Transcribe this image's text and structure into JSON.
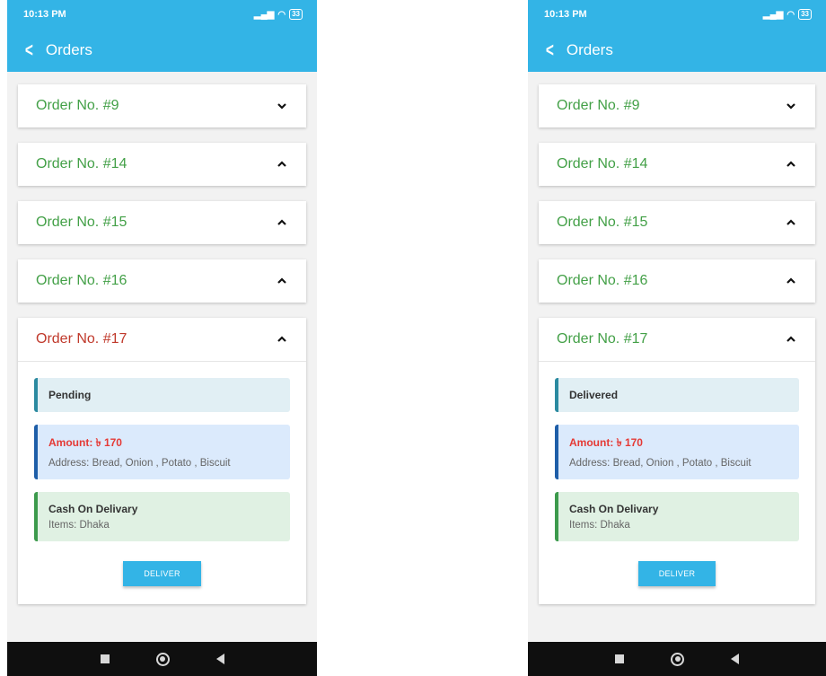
{
  "screens": [
    {
      "status": {
        "time": "10:13 PM",
        "battery": "33"
      },
      "appbar": {
        "back_icon": "chevron-left-icon",
        "title": "Orders"
      },
      "orders": [
        {
          "title": "Order No. #9"
        },
        {
          "title": "Order No. #14"
        },
        {
          "title": "Order No. #15"
        },
        {
          "title": "Order No. #16"
        },
        {
          "title": "Order No. #17"
        }
      ],
      "expanded": {
        "status": "Pending",
        "amount": "Amount: ৳ 170",
        "address": "Address: Bread, Onion , Potato , Biscuit",
        "payment": "Cash On Delivary",
        "items": "Items: Dhaka",
        "button": "DELIVER"
      }
    },
    {
      "status": {
        "time": "10:13 PM",
        "battery": "33"
      },
      "appbar": {
        "back_icon": "chevron-left-icon",
        "title": "Orders"
      },
      "orders": [
        {
          "title": "Order No. #9"
        },
        {
          "title": "Order No. #14"
        },
        {
          "title": "Order No. #15"
        },
        {
          "title": "Order No. #16"
        },
        {
          "title": "Order No. #17"
        }
      ],
      "expanded": {
        "status": "Delivered",
        "amount": "Amount: ৳ 170",
        "address": "Address: Bread, Onion , Potato , Biscuit",
        "payment": "Cash On Delivary",
        "items": "Items: Dhaka",
        "button": "DELIVER"
      }
    }
  ],
  "colors": {
    "primary": "#33b4e6",
    "order_title": "#43a047",
    "active_order_title": "#c0392b",
    "amount": "#e53935"
  }
}
